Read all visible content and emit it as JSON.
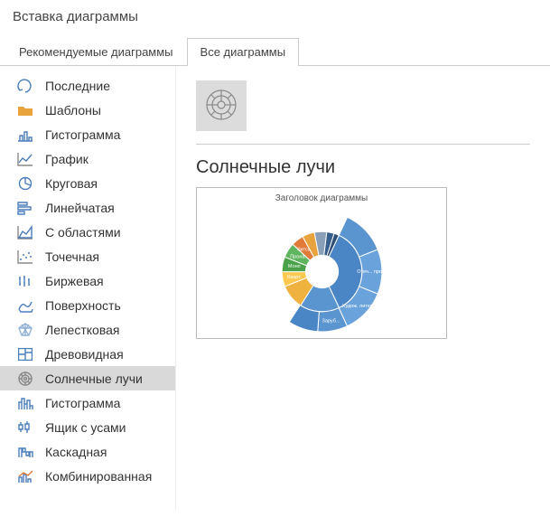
{
  "dialog": {
    "title": "Вставка диаграммы"
  },
  "tabs": {
    "recommended": "Рекомендуемые диаграммы",
    "all": "Все диаграммы",
    "active": "all"
  },
  "sidebar": {
    "items": [
      {
        "id": "recent",
        "label": "Последние"
      },
      {
        "id": "templates",
        "label": "Шаблоны"
      },
      {
        "id": "column",
        "label": "Гистограмма"
      },
      {
        "id": "line",
        "label": "График"
      },
      {
        "id": "pie",
        "label": "Круговая"
      },
      {
        "id": "bar",
        "label": "Линейчатая"
      },
      {
        "id": "area",
        "label": "С областями"
      },
      {
        "id": "scatter",
        "label": "Точечная"
      },
      {
        "id": "stock",
        "label": "Биржевая"
      },
      {
        "id": "surface",
        "label": "Поверхность"
      },
      {
        "id": "radar",
        "label": "Лепестковая"
      },
      {
        "id": "treemap",
        "label": "Древовидная"
      },
      {
        "id": "sunburst",
        "label": "Солнечные лучи"
      },
      {
        "id": "histogram",
        "label": "Гистограмма"
      },
      {
        "id": "boxwhisker",
        "label": "Ящик с усами"
      },
      {
        "id": "waterfall",
        "label": "Каскадная"
      },
      {
        "id": "combo",
        "label": "Комбинированная"
      }
    ],
    "selected": "sunburst"
  },
  "content": {
    "subtype_title": "Солнечные лучи",
    "preview_title": "Заголовок диаграммы"
  },
  "chart_data": {
    "type": "sunburst",
    "title": "Заголовок диаграммы",
    "inner_segments": [
      {
        "label": "",
        "value": 36,
        "color": "#4a86c5"
      },
      {
        "label": "",
        "value": 16,
        "color": "#5a95d0"
      },
      {
        "label": "",
        "value": 10,
        "color": "#f0b23e"
      },
      {
        "label": "Кварт.",
        "value": 6,
        "color": "#ffc84e"
      },
      {
        "label": "Моно",
        "value": 6,
        "color": "#4aa24a"
      },
      {
        "label": "Прона.",
        "value": 6,
        "color": "#5fb55f"
      },
      {
        "label": "Китсо.",
        "value": 5,
        "color": "#e07b3a"
      },
      {
        "label": "",
        "value": 5,
        "color": "#e8a33d"
      },
      {
        "label": "",
        "value": 5,
        "color": "#8aa0b8"
      },
      {
        "label": "",
        "value": 3,
        "color": "#365f8c"
      },
      {
        "label": "",
        "value": 2,
        "color": "#2f4f77"
      }
    ],
    "outer_segments": [
      {
        "label": "",
        "value": 12,
        "color": "#5a95d0"
      },
      {
        "label": "Отеч... проза",
        "value": 12,
        "color": "#6aa3db"
      },
      {
        "label": "Худож. литер.",
        "value": 12,
        "color": "#6aa3db"
      },
      {
        "label": "Заруб...",
        "value": 8,
        "color": "#5a95d0"
      },
      {
        "label": "",
        "value": 8,
        "color": "#4a86c5"
      }
    ]
  }
}
